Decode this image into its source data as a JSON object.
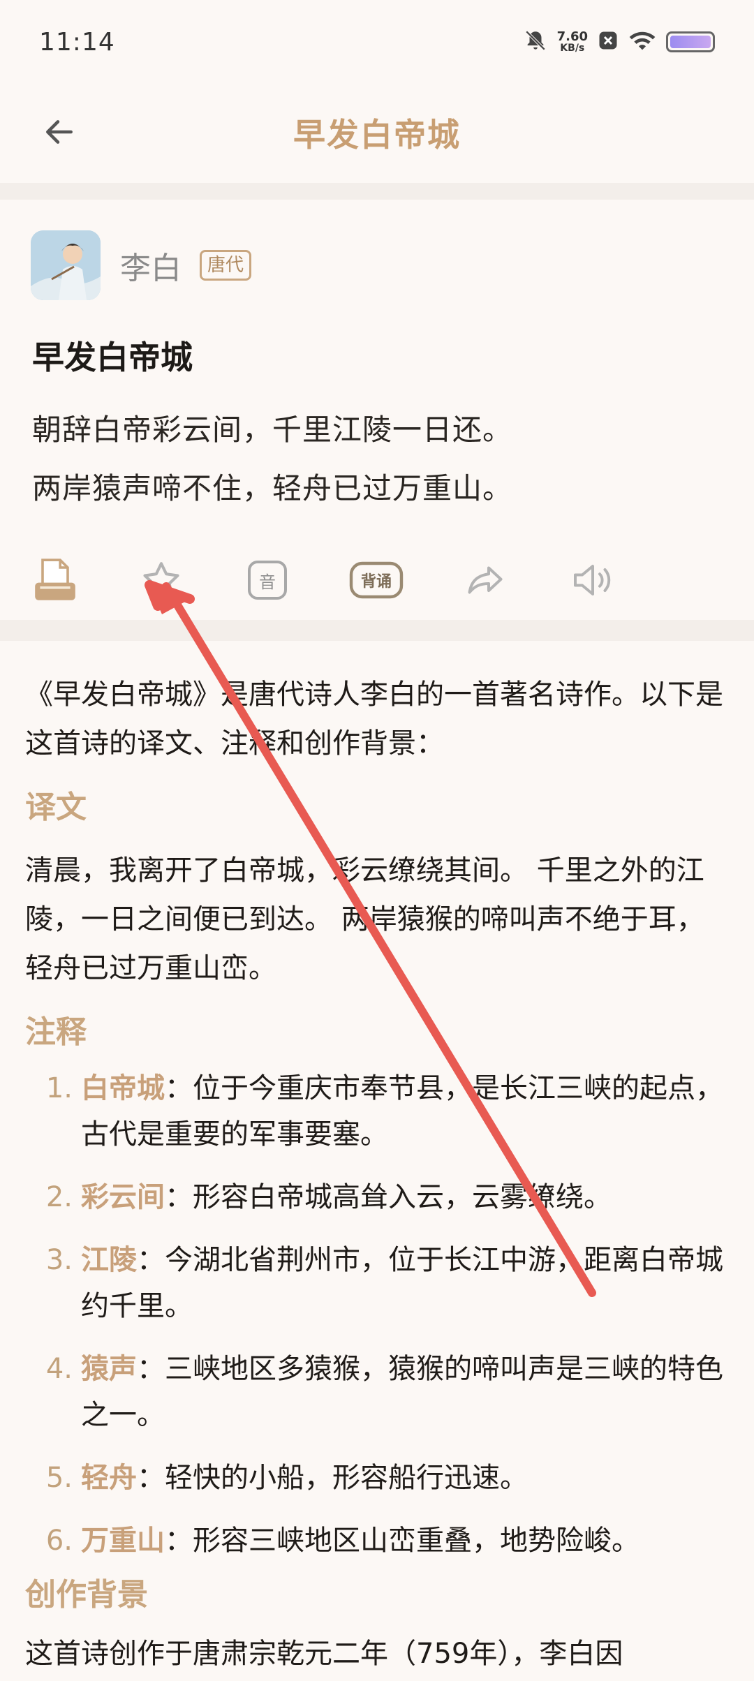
{
  "status": {
    "time": "11:14",
    "net_speed": "7.60",
    "net_unit": "KB/s",
    "icons": [
      "bell-muted-icon",
      "close-box-icon",
      "wifi-icon",
      "battery-icon"
    ]
  },
  "appbar": {
    "title": "早发白帝城",
    "back_icon": "back-arrow-icon"
  },
  "poem": {
    "author": "李白",
    "dynasty": "唐代",
    "title": "早发白帝城",
    "lines": [
      "朝辞白帝彩云间，千里江陵一日还。",
      "两岸猿声啼不住，轻舟已过万重山。"
    ]
  },
  "toolbar": {
    "items": [
      {
        "icon": "printer-icon"
      },
      {
        "icon": "star-icon"
      },
      {
        "icon": "pinyin-icon",
        "label": "音"
      },
      {
        "icon": "recite-icon",
        "label": "背诵"
      },
      {
        "icon": "share-icon"
      },
      {
        "icon": "speaker-icon"
      }
    ]
  },
  "article": {
    "intro": "《早发白帝城》是唐代诗人李白的一首著名诗作。以下是这首诗的译文、注释和创作背景：",
    "translation_heading": "译文",
    "translation": "清晨，我离开了白帝城，彩云缭绕其间。 千里之外的江陵，一日之间便已到达。 两岸猿猴的啼叫声不绝于耳， 轻舟已过万重山峦。",
    "notes_heading": "注释",
    "notes": [
      {
        "num": "1.",
        "term": "白帝城",
        "text": "：位于今重庆市奉节县，是长江三峡的起点，古代是重要的军事要塞。"
      },
      {
        "num": "2.",
        "term": "彩云间",
        "text": "：形容白帝城高耸入云，云雾缭绕。"
      },
      {
        "num": "3.",
        "term": "江陵",
        "text": "：今湖北省荆州市，位于长江中游，距离白帝城约千里。"
      },
      {
        "num": "4.",
        "term": "猿声",
        "text": "：三峡地区多猿猴，猿猴的啼叫声是三峡的特色之一。"
      },
      {
        "num": "5.",
        "term": "轻舟",
        "text": "：轻快的小船，形容船行迅速。"
      },
      {
        "num": "6.",
        "term": "万重山",
        "text": "：形容三峡地区山峦重叠，地势险峻。"
      }
    ],
    "background_heading": "创作背景",
    "background_partial": "这首诗创作于唐肃宗乾元二年（759年），李白因"
  },
  "colors": {
    "accent": "#c9a67f",
    "annotation_arrow": "#e85a52",
    "background": "#fcf8f5"
  }
}
